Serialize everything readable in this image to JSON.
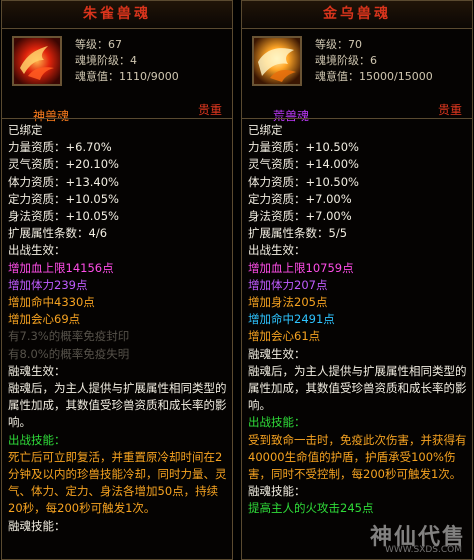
{
  "left": {
    "title": "朱雀兽魂",
    "level": "等级：67",
    "tier": "魂境阶级：4",
    "soul": "魂意值：1110/9000",
    "kind": "神兽魂",
    "rarity": "贵重",
    "bound": "已绑定",
    "stats": [
      "力量资质：+6.70%",
      "灵气资质：+20.10%",
      "体力资质：+13.40%",
      "定力资质：+10.05%",
      "身法资质：+10.05%"
    ],
    "ext": "扩展属性条数：4/6",
    "battle_head": "出战生效：",
    "b1": "增加血上限14156点",
    "b2": "增加体力239点",
    "b3": "增加命中4330点",
    "b4": "增加会心69点",
    "d1": "有7.3%的概率免疫封印",
    "d2": "有8.0%的概率免疫失明",
    "fuse_head": "融魂生效：",
    "fuse_text": "融魂后，为主人提供与扩展属性相同类型的属性加成，其数值受珍兽资质和成长率的影响。",
    "skill_head": "出战技能：",
    "skill_text": "死亡后可立即复活，并重置原冷却时间在2分钟及以内的珍兽技能冷却，同时力量、灵气、体力、定力、身法各增加50点，持续20秒，每200秒可触发1次。",
    "fuse_skill": "融魂技能："
  },
  "right": {
    "title": "金乌兽魂",
    "level": "等级：70",
    "tier": "魂境阶级：6",
    "soul": "魂意值：15000/15000",
    "kind": "荒兽魂",
    "rarity": "贵重",
    "bound": "已绑定",
    "stats": [
      "力量资质：+10.50%",
      "灵气资质：+14.00%",
      "体力资质：+10.50%",
      "定力资质：+7.00%",
      "身法资质：+7.00%"
    ],
    "ext": "扩展属性条数：5/5",
    "battle_head": "出战生效：",
    "b1": "增加血上限10759点",
    "b2": "增加体力207点",
    "b3": "增加身法205点",
    "b4": "增加命中2491点",
    "b5": "增加会心61点",
    "fuse_head": "融魂生效：",
    "fuse_text": "融魂后，为主人提供与扩展属性相同类型的属性加成，其数值受珍兽资质和成长率的影响。",
    "skill_head": "出战技能：",
    "skill_text": "受到致命一击时，免疫此次伤害，并获得有40000生命值的护盾，护盾承受100%伤害，同时不受控制，每200秒可触发1次。",
    "fuse_skill": "融魂技能：",
    "fuse_skill_text": "提高主人的火攻击245点"
  },
  "watermark": {
    "text": "神仙代售",
    "url": "WWW.SXDS.COM"
  },
  "icons": {
    "left": "vermilion-bird-icon",
    "right": "golden-crow-icon"
  },
  "colors": {
    "title": "#d8341c",
    "border": "#5a4a30",
    "green": "#2fdc39",
    "pink": "#ff4de8",
    "orange": "#f6a321",
    "blue": "#2ec4ff"
  }
}
